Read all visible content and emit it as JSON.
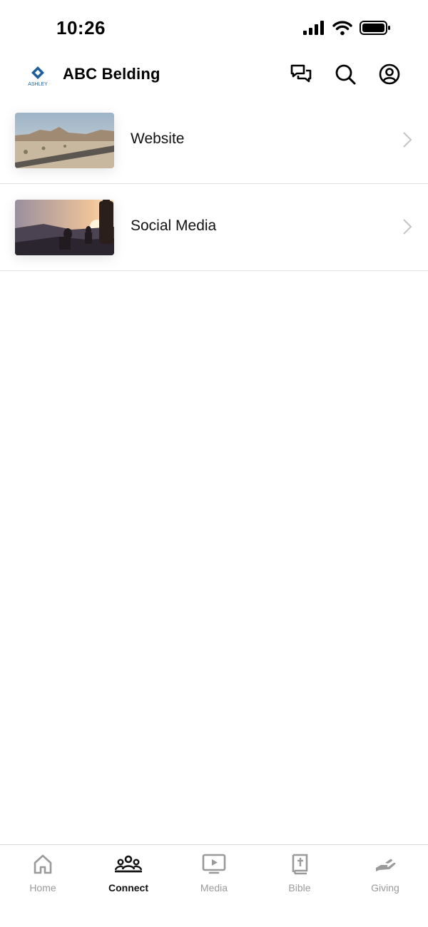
{
  "status_bar": {
    "time": "10:26"
  },
  "header": {
    "title": "ABC Belding",
    "logo_text": "ASHLEY"
  },
  "links": [
    {
      "label": "Website",
      "thumbnail": "desert-road-photo"
    },
    {
      "label": "Social Media",
      "thumbnail": "sunset-hikers-photo"
    }
  ],
  "tabs": [
    {
      "label": "Home",
      "icon": "home-icon",
      "active": false
    },
    {
      "label": "Connect",
      "icon": "people-icon",
      "active": true
    },
    {
      "label": "Media",
      "icon": "play-screen-icon",
      "active": false
    },
    {
      "label": "Bible",
      "icon": "bible-icon",
      "active": false
    },
    {
      "label": "Giving",
      "icon": "giving-hand-icon",
      "active": false
    }
  ],
  "colors": {
    "active": "#111111",
    "inactive": "#9a9a9a",
    "logo_blue": "#1f5e9c"
  }
}
